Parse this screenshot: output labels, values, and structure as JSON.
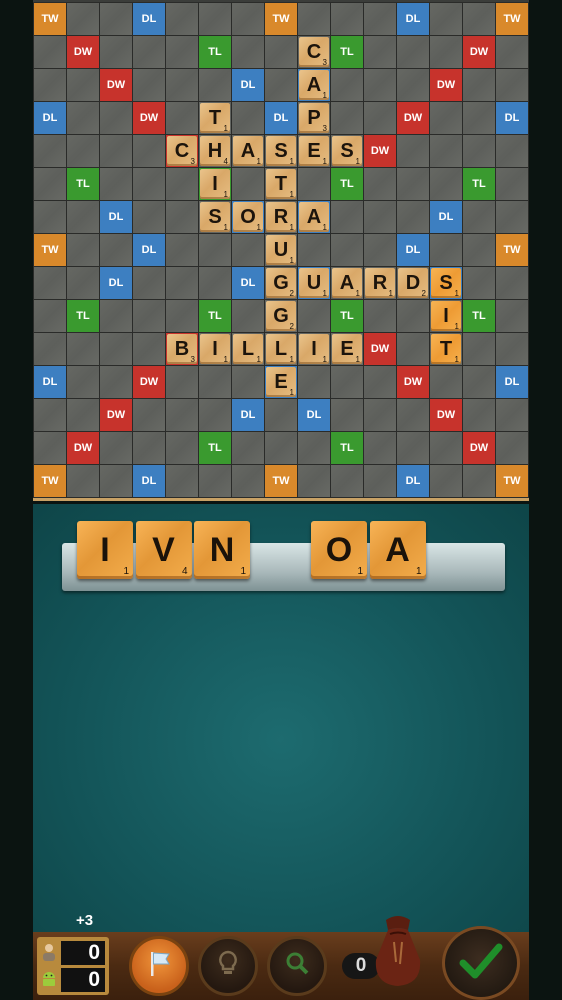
{
  "board": {
    "size": 15,
    "premium_labels": {
      "TW": "TW",
      "DW": "DW",
      "TL": "TL",
      "DL": "DL"
    },
    "premium_map": [
      "TW . . DL . . . TW . . . DL . . TW",
      ". DW . . . TL . . . TL . . . DW .",
      ". . DW . . . DL . DL . . . DW . .",
      "DL . . DW . . . DL . . . DW . . DL",
      ". . . . DW . . . . . DW . . . .",
      ". TL . . . TL . . . TL . . . TL .",
      ". . DL . . . DL . DL . . . DL . .",
      "TW . . DL . . . ST . . . DL . . TW",
      ". . DL . . . DL . DL . . . DL . .",
      ". TL . . . TL . . . TL . . . TL .",
      ". . . . DW . . . . . DW . . . .",
      "DL . . DW . . . DL . . . DW . . DL",
      ". . DW . . . DL . DL . . . DW . .",
      ". DW . . . TL . . . TL . . . DW .",
      "TW . . DL . . . TW . . . DL . . TW"
    ],
    "tiles": [
      {
        "row": 1,
        "col": 8,
        "letter": "C",
        "points": 3
      },
      {
        "row": 2,
        "col": 8,
        "letter": "A",
        "points": 1
      },
      {
        "row": 3,
        "col": 5,
        "letter": "T",
        "points": 1
      },
      {
        "row": 3,
        "col": 8,
        "letter": "P",
        "points": 3
      },
      {
        "row": 4,
        "col": 4,
        "letter": "C",
        "points": 3
      },
      {
        "row": 4,
        "col": 5,
        "letter": "H",
        "points": 4
      },
      {
        "row": 4,
        "col": 6,
        "letter": "A",
        "points": 1
      },
      {
        "row": 4,
        "col": 7,
        "letter": "S",
        "points": 1
      },
      {
        "row": 4,
        "col": 8,
        "letter": "E",
        "points": 1
      },
      {
        "row": 4,
        "col": 9,
        "letter": "S",
        "points": 1
      },
      {
        "row": 5,
        "col": 5,
        "letter": "I",
        "points": 1
      },
      {
        "row": 5,
        "col": 7,
        "letter": "T",
        "points": 1
      },
      {
        "row": 6,
        "col": 5,
        "letter": "S",
        "points": 1
      },
      {
        "row": 6,
        "col": 6,
        "letter": "O",
        "points": 1
      },
      {
        "row": 6,
        "col": 7,
        "letter": "R",
        "points": 1
      },
      {
        "row": 6,
        "col": 8,
        "letter": "A",
        "points": 1
      },
      {
        "row": 7,
        "col": 7,
        "letter": "U",
        "points": 1
      },
      {
        "row": 8,
        "col": 7,
        "letter": "G",
        "points": 2
      },
      {
        "row": 8,
        "col": 8,
        "letter": "U",
        "points": 1
      },
      {
        "row": 8,
        "col": 9,
        "letter": "A",
        "points": 1
      },
      {
        "row": 8,
        "col": 10,
        "letter": "R",
        "points": 1
      },
      {
        "row": 8,
        "col": 11,
        "letter": "D",
        "points": 2
      },
      {
        "row": 8,
        "col": 12,
        "letter": "S",
        "points": 1,
        "fresh": true
      },
      {
        "row": 9,
        "col": 7,
        "letter": "G",
        "points": 2
      },
      {
        "row": 9,
        "col": 12,
        "letter": "I",
        "points": 1,
        "fresh": true
      },
      {
        "row": 10,
        "col": 4,
        "letter": "B",
        "points": 3
      },
      {
        "row": 10,
        "col": 5,
        "letter": "I",
        "points": 1
      },
      {
        "row": 10,
        "col": 6,
        "letter": "L",
        "points": 1
      },
      {
        "row": 10,
        "col": 7,
        "letter": "L",
        "points": 1
      },
      {
        "row": 10,
        "col": 8,
        "letter": "I",
        "points": 1
      },
      {
        "row": 10,
        "col": 9,
        "letter": "E",
        "points": 1
      },
      {
        "row": 10,
        "col": 12,
        "letter": "T",
        "points": 1,
        "fresh": true
      },
      {
        "row": 11,
        "col": 7,
        "letter": "E",
        "points": 1
      }
    ]
  },
  "rack": {
    "tiles": [
      {
        "letter": "I",
        "points": "1",
        "slot": 0
      },
      {
        "letter": "V",
        "points": "4",
        "slot": 1
      },
      {
        "letter": "N",
        "points": "1",
        "slot": 2
      },
      {
        "letter": "O",
        "points": "1",
        "slot": 4
      },
      {
        "letter": "A",
        "points": "1",
        "slot": 5
      }
    ]
  },
  "footer": {
    "bonus": "+3",
    "player_score": "0",
    "opponent_score": "0",
    "bag_count": "0"
  },
  "colors": {
    "tw": "#d9892b",
    "dw": "#c7332c",
    "tl": "#3a9a2f",
    "dl": "#3d7fc1",
    "tile": "#e0b575",
    "fresh_tile": "#f2a944",
    "table": "#135458"
  },
  "icons": {
    "flag": "flag-icon",
    "hint": "lightbulb-icon",
    "search": "magnifier-icon",
    "bag": "tile-bag-icon",
    "submit": "checkmark-icon",
    "player": "person-icon",
    "opponent": "android-icon"
  }
}
